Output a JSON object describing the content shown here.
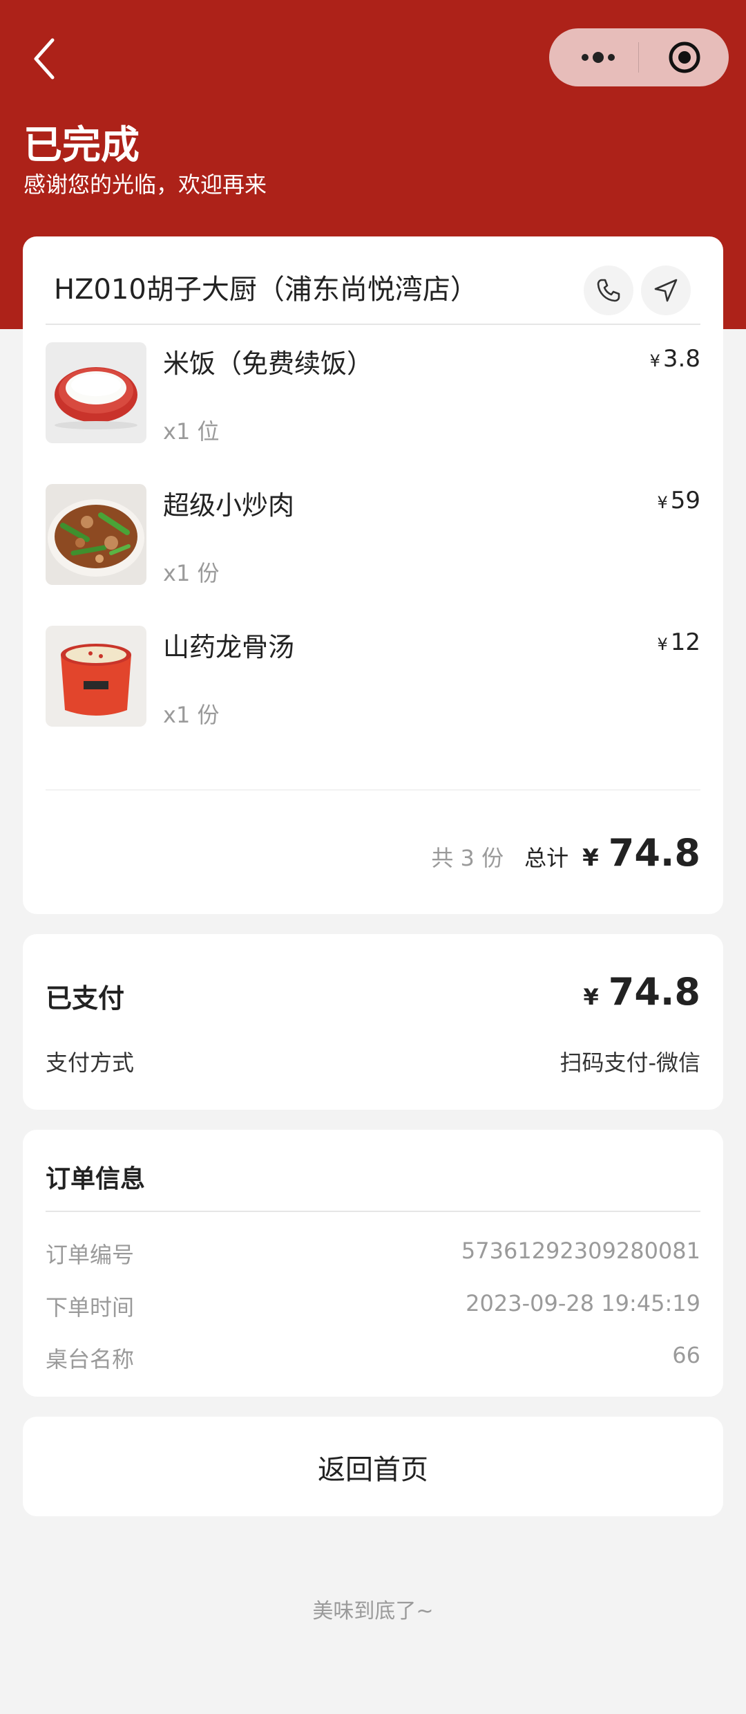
{
  "header": {
    "status_title": "已完成",
    "status_subtitle": "感谢您的光临，欢迎再来",
    "back_icon": "chevron-left-icon",
    "capsule_icons": [
      "more-dots-icon",
      "target-icon"
    ],
    "brand_color": "#ad2219"
  },
  "order": {
    "store_name": "HZ010胡子大厨（浦东尚悦湾店）",
    "actions": [
      "phone-icon",
      "navigation-icon"
    ],
    "items": [
      {
        "name": "米饭（免费续饭）",
        "qty": "x1 位",
        "currency": "¥",
        "price": "3.8",
        "image": "rice-bowl"
      },
      {
        "name": "超级小炒肉",
        "qty": "x1 份",
        "currency": "¥",
        "price": "59",
        "image": "stir-fried-pork"
      },
      {
        "name": "山药龙骨汤",
        "qty": "x1 份",
        "currency": "¥",
        "price": "12",
        "image": "yam-pork-bone-soup"
      }
    ],
    "count_text": "共 3 份",
    "total_label": "总计",
    "total_currency": "¥",
    "total_amount": "74.8"
  },
  "payment": {
    "paid_label": "已支付",
    "currency": "¥",
    "paid_amount": "74.8",
    "method_label": "支付方式",
    "method_value": "扫码支付-微信"
  },
  "order_info": {
    "title": "订单信息",
    "rows": [
      {
        "label": "订单编号",
        "value": "5736129230928008 1"
      },
      {
        "label": "下单时间",
        "value": "2023-09-28 19:45:19"
      },
      {
        "label": "桌台名称",
        "value": "66"
      }
    ]
  },
  "home_button_label": "返回首页",
  "footer_text": "美味到底了~"
}
